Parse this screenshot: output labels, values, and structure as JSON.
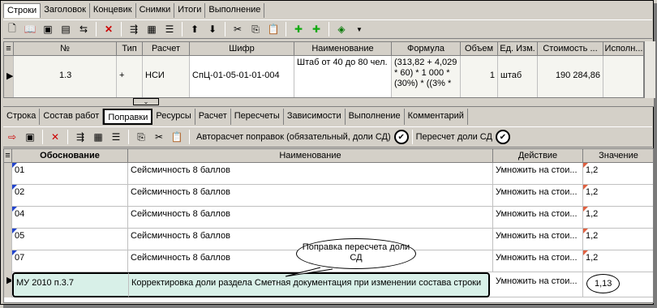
{
  "top_tabs": [
    "Строки",
    "Заголовок",
    "Концевик",
    "Снимки",
    "Итоги",
    "Выполнение"
  ],
  "upper_grid": {
    "columns": [
      "№",
      "Тип",
      "Расчет",
      "Шифр",
      "Наименование",
      "Формула",
      "Объем",
      "Ед. Изм.",
      "Стоимость ...",
      "Исполн..."
    ],
    "row": {
      "num": "1.3",
      "type": "+",
      "calc": "НСИ",
      "code": "СпЦ-01-05-01-01-004",
      "name": "Штаб от 40 до 80 чел.",
      "formula": "(313,82 + 4,029 * 60) * 1 000 * (30%) * ((3% *",
      "volume": "1",
      "unit": "штаб",
      "cost": "190 284,86"
    }
  },
  "lower_tabs": [
    "Строка",
    "Состав работ",
    "Поправки",
    "Ресурсы",
    "Расчет",
    "Пересчеты",
    "Зависимости",
    "Выполнение",
    "Комментарий"
  ],
  "toolbar2": {
    "auto_label": "Авторасчет поправок (обязательный, доли СД)",
    "recalc_label": "Пересчет доли СД"
  },
  "lower_grid": {
    "columns": [
      "Обоснование",
      "Наименование",
      "Действие",
      "Значение"
    ],
    "rows": [
      {
        "basis": "01",
        "name": "Сейсмичность 8 баллов",
        "action": "Умножить на стои...",
        "value": "1,2"
      },
      {
        "basis": "02",
        "name": "Сейсмичность 8 баллов",
        "action": "Умножить на стои...",
        "value": "1,2"
      },
      {
        "basis": "04",
        "name": "Сейсмичность 8 баллов",
        "action": "Умножить на стои...",
        "value": "1,2"
      },
      {
        "basis": "05",
        "name": "Сейсмичность 8 баллов",
        "action": "Умножить на стои...",
        "value": "1,2"
      },
      {
        "basis": "07",
        "name": "Сейсмичность 8 баллов",
        "action": "Умножить на стои...",
        "value": "1,2"
      },
      {
        "basis": "МУ 2010 п.3.7",
        "name": "Корректировка доли раздела Сметная документация при изменении состава строки",
        "action": "Умножить на стои...",
        "value": "1,13"
      }
    ]
  },
  "callout": "Поправка пересчета доли СД",
  "colors": {
    "selected_row": "#d8f0e8",
    "marker_blue": "#2244cc",
    "marker_red": "#e06040"
  }
}
